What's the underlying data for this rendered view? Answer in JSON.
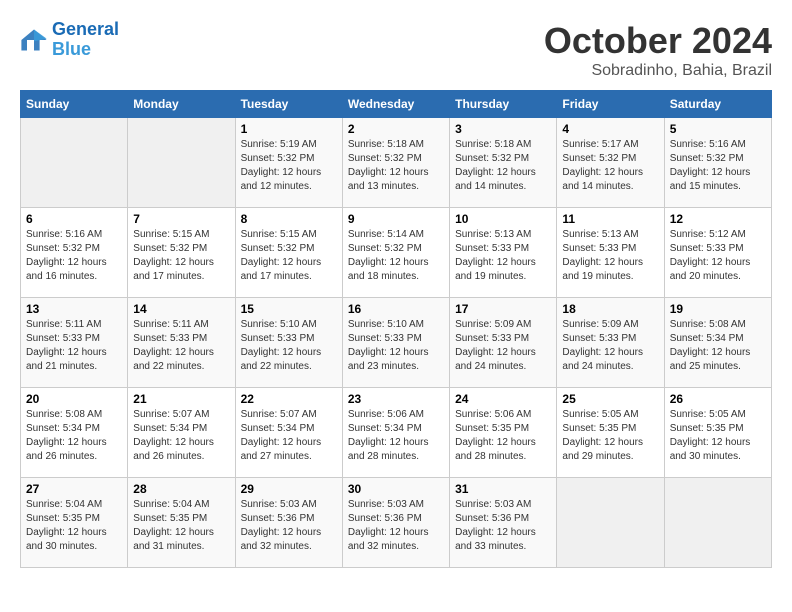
{
  "header": {
    "logo_line1": "General",
    "logo_line2": "Blue",
    "title": "October 2024",
    "subtitle": "Sobradinho, Bahia, Brazil"
  },
  "weekdays": [
    "Sunday",
    "Monday",
    "Tuesday",
    "Wednesday",
    "Thursday",
    "Friday",
    "Saturday"
  ],
  "weeks": [
    [
      {
        "day": "",
        "info": ""
      },
      {
        "day": "",
        "info": ""
      },
      {
        "day": "1",
        "info": "Sunrise: 5:19 AM\nSunset: 5:32 PM\nDaylight: 12 hours\nand 12 minutes."
      },
      {
        "day": "2",
        "info": "Sunrise: 5:18 AM\nSunset: 5:32 PM\nDaylight: 12 hours\nand 13 minutes."
      },
      {
        "day": "3",
        "info": "Sunrise: 5:18 AM\nSunset: 5:32 PM\nDaylight: 12 hours\nand 14 minutes."
      },
      {
        "day": "4",
        "info": "Sunrise: 5:17 AM\nSunset: 5:32 PM\nDaylight: 12 hours\nand 14 minutes."
      },
      {
        "day": "5",
        "info": "Sunrise: 5:16 AM\nSunset: 5:32 PM\nDaylight: 12 hours\nand 15 minutes."
      }
    ],
    [
      {
        "day": "6",
        "info": "Sunrise: 5:16 AM\nSunset: 5:32 PM\nDaylight: 12 hours\nand 16 minutes."
      },
      {
        "day": "7",
        "info": "Sunrise: 5:15 AM\nSunset: 5:32 PM\nDaylight: 12 hours\nand 17 minutes."
      },
      {
        "day": "8",
        "info": "Sunrise: 5:15 AM\nSunset: 5:32 PM\nDaylight: 12 hours\nand 17 minutes."
      },
      {
        "day": "9",
        "info": "Sunrise: 5:14 AM\nSunset: 5:32 PM\nDaylight: 12 hours\nand 18 minutes."
      },
      {
        "day": "10",
        "info": "Sunrise: 5:13 AM\nSunset: 5:33 PM\nDaylight: 12 hours\nand 19 minutes."
      },
      {
        "day": "11",
        "info": "Sunrise: 5:13 AM\nSunset: 5:33 PM\nDaylight: 12 hours\nand 19 minutes."
      },
      {
        "day": "12",
        "info": "Sunrise: 5:12 AM\nSunset: 5:33 PM\nDaylight: 12 hours\nand 20 minutes."
      }
    ],
    [
      {
        "day": "13",
        "info": "Sunrise: 5:11 AM\nSunset: 5:33 PM\nDaylight: 12 hours\nand 21 minutes."
      },
      {
        "day": "14",
        "info": "Sunrise: 5:11 AM\nSunset: 5:33 PM\nDaylight: 12 hours\nand 22 minutes."
      },
      {
        "day": "15",
        "info": "Sunrise: 5:10 AM\nSunset: 5:33 PM\nDaylight: 12 hours\nand 22 minutes."
      },
      {
        "day": "16",
        "info": "Sunrise: 5:10 AM\nSunset: 5:33 PM\nDaylight: 12 hours\nand 23 minutes."
      },
      {
        "day": "17",
        "info": "Sunrise: 5:09 AM\nSunset: 5:33 PM\nDaylight: 12 hours\nand 24 minutes."
      },
      {
        "day": "18",
        "info": "Sunrise: 5:09 AM\nSunset: 5:33 PM\nDaylight: 12 hours\nand 24 minutes."
      },
      {
        "day": "19",
        "info": "Sunrise: 5:08 AM\nSunset: 5:34 PM\nDaylight: 12 hours\nand 25 minutes."
      }
    ],
    [
      {
        "day": "20",
        "info": "Sunrise: 5:08 AM\nSunset: 5:34 PM\nDaylight: 12 hours\nand 26 minutes."
      },
      {
        "day": "21",
        "info": "Sunrise: 5:07 AM\nSunset: 5:34 PM\nDaylight: 12 hours\nand 26 minutes."
      },
      {
        "day": "22",
        "info": "Sunrise: 5:07 AM\nSunset: 5:34 PM\nDaylight: 12 hours\nand 27 minutes."
      },
      {
        "day": "23",
        "info": "Sunrise: 5:06 AM\nSunset: 5:34 PM\nDaylight: 12 hours\nand 28 minutes."
      },
      {
        "day": "24",
        "info": "Sunrise: 5:06 AM\nSunset: 5:35 PM\nDaylight: 12 hours\nand 28 minutes."
      },
      {
        "day": "25",
        "info": "Sunrise: 5:05 AM\nSunset: 5:35 PM\nDaylight: 12 hours\nand 29 minutes."
      },
      {
        "day": "26",
        "info": "Sunrise: 5:05 AM\nSunset: 5:35 PM\nDaylight: 12 hours\nand 30 minutes."
      }
    ],
    [
      {
        "day": "27",
        "info": "Sunrise: 5:04 AM\nSunset: 5:35 PM\nDaylight: 12 hours\nand 30 minutes."
      },
      {
        "day": "28",
        "info": "Sunrise: 5:04 AM\nSunset: 5:35 PM\nDaylight: 12 hours\nand 31 minutes."
      },
      {
        "day": "29",
        "info": "Sunrise: 5:03 AM\nSunset: 5:36 PM\nDaylight: 12 hours\nand 32 minutes."
      },
      {
        "day": "30",
        "info": "Sunrise: 5:03 AM\nSunset: 5:36 PM\nDaylight: 12 hours\nand 32 minutes."
      },
      {
        "day": "31",
        "info": "Sunrise: 5:03 AM\nSunset: 5:36 PM\nDaylight: 12 hours\nand 33 minutes."
      },
      {
        "day": "",
        "info": ""
      },
      {
        "day": "",
        "info": ""
      }
    ]
  ]
}
